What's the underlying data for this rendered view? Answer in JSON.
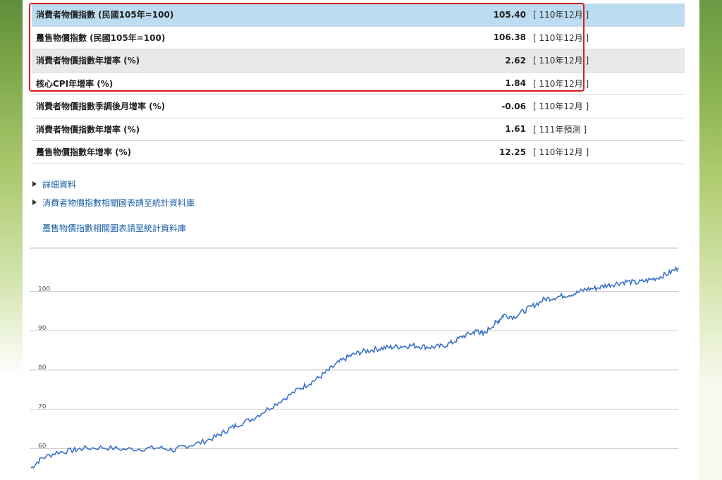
{
  "stats": [
    {
      "label": "消費者物價指數 (民國105年=100)",
      "value": "105.40",
      "period": "[ 110年12月 ]"
    },
    {
      "label": "躉售物價指數 (民國105年=100)",
      "value": "106.38",
      "period": "[ 110年12月 ]"
    },
    {
      "label": "消費者物價指數年增率 (%)",
      "value": "2.62",
      "period": "[ 110年12月 ]"
    },
    {
      "label": "核心CPI年增率 (%)",
      "value": "1.84",
      "period": "[ 110年12月 ]"
    },
    {
      "label": "消費者物價指數季調後月增率 (%)",
      "value": "-0.06",
      "period": "[ 110年12月 ]"
    },
    {
      "label": "消費者物價指數年增率 (%)",
      "value": "1.61",
      "period": "[ 111年預測 ]"
    },
    {
      "label": "躉售物價指數年增率 (%)",
      "value": "12.25",
      "period": "[ 110年12月 ]"
    }
  ],
  "links": {
    "detail": "詳細資料",
    "cpi_charts": "消費者物價指數相關圖表請至統計資料庫",
    "wpi_charts": "躉售物價指數相關圖表請至統計資料庫"
  },
  "chart_data": {
    "type": "line",
    "series_color": "#3a72c8",
    "ylim": [
      52,
      111
    ],
    "yticks": [
      60,
      70,
      80,
      90,
      100
    ],
    "tick_labels": [
      "60",
      "70",
      "80",
      "90",
      "100"
    ],
    "grid": true,
    "points": [
      [
        0,
        55.0
      ],
      [
        2,
        57.5
      ],
      [
        5,
        59.0
      ],
      [
        8,
        59.5
      ],
      [
        10,
        60.0
      ],
      [
        14,
        60.3
      ],
      [
        18,
        59.8
      ],
      [
        22,
        60.0
      ],
      [
        25,
        60.2
      ],
      [
        28,
        59.6
      ],
      [
        30,
        60.6
      ],
      [
        33,
        61.5
      ],
      [
        36,
        63.0
      ],
      [
        38,
        64.5
      ],
      [
        40,
        66.0
      ],
      [
        43,
        67.5
      ],
      [
        46,
        70.0
      ],
      [
        49,
        72.5
      ],
      [
        52,
        75.0
      ],
      [
        54,
        76.5
      ],
      [
        56,
        78.0
      ],
      [
        58,
        80.0
      ],
      [
        60,
        82.0
      ],
      [
        62,
        83.5
      ],
      [
        64,
        84.5
      ],
      [
        66,
        85.0
      ],
      [
        68,
        85.5
      ],
      [
        70,
        85.8
      ],
      [
        72,
        86.0
      ],
      [
        74,
        86.2
      ],
      [
        76,
        86.0
      ],
      [
        78,
        85.8
      ],
      [
        80,
        86.0
      ],
      [
        82,
        87.0
      ],
      [
        84,
        88.5
      ],
      [
        86,
        89.5
      ],
      [
        87,
        90.0
      ],
      [
        88,
        89.0
      ],
      [
        90,
        91.5
      ],
      [
        91,
        92.5
      ],
      [
        92,
        94.0
      ],
      [
        94,
        93.5
      ],
      [
        96,
        95.0
      ],
      [
        98,
        96.5
      ],
      [
        100,
        98.0
      ],
      [
        102,
        98.5
      ],
      [
        104,
        99.0
      ],
      [
        106,
        99.5
      ],
      [
        108,
        100.5
      ],
      [
        110,
        100.8
      ],
      [
        112,
        101.5
      ],
      [
        114,
        102.0
      ],
      [
        116,
        102.5
      ],
      [
        118,
        102.2
      ],
      [
        120,
        102.8
      ],
      [
        122,
        103.5
      ],
      [
        124,
        104.5
      ],
      [
        126,
        106.0
      ]
    ]
  },
  "colors": {
    "row_highlight": "#bcdcf1",
    "row_alt": "#e9e9e9",
    "annotation_red": "#d81e1e",
    "link_blue": "#1a5fa8"
  }
}
